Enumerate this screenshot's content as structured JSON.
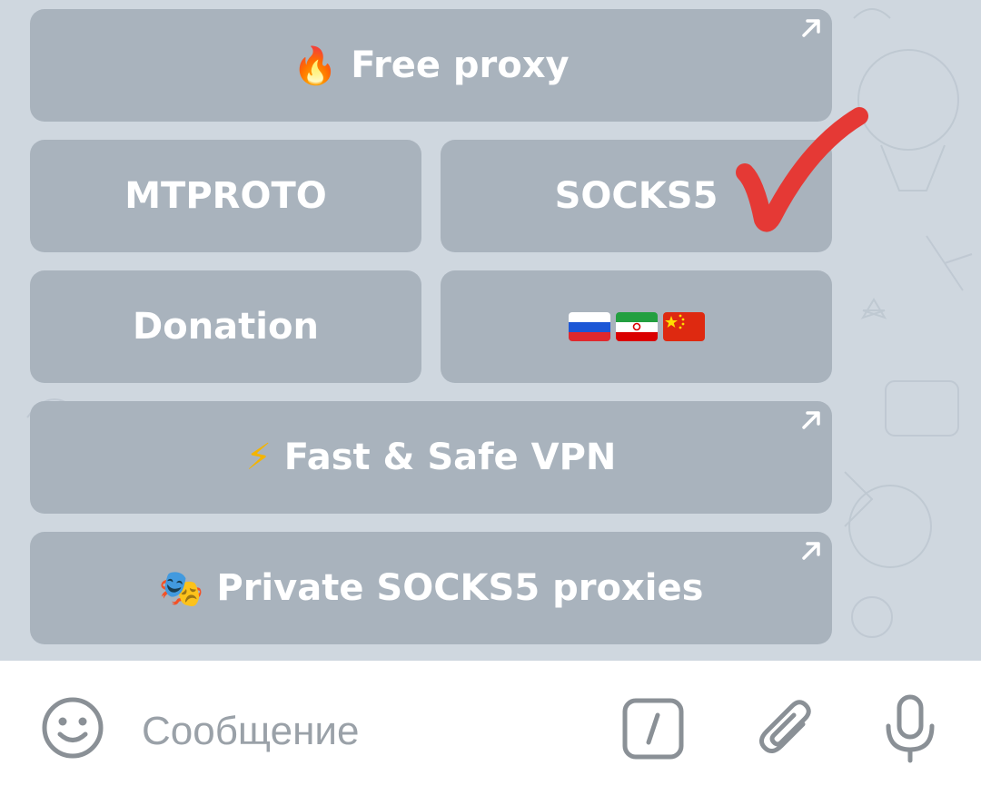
{
  "keyboard": {
    "free_proxy": {
      "emoji": "🔥",
      "label": "Free proxy",
      "has_link_arrow": true
    },
    "mtproto": {
      "label": "MTPROTO"
    },
    "socks5": {
      "label": "SOCKS5"
    },
    "donation": {
      "label": "Donation"
    },
    "flags": {
      "flags": [
        "russia-flag",
        "iran-flag",
        "china-flag"
      ]
    },
    "vpn": {
      "emoji": "⚡",
      "label": "Fast & Safe VPN",
      "has_link_arrow": true
    },
    "private_socks": {
      "emoji": "🎭",
      "label": "Private SOCKS5 proxies",
      "has_link_arrow": true
    }
  },
  "annotation": {
    "mark": "red-checkmark",
    "color": "#e53935"
  },
  "composer": {
    "placeholder": "Сообщение",
    "icons": [
      "emoji-icon",
      "bot-commands-icon",
      "attach-icon",
      "microphone-icon"
    ]
  },
  "colors": {
    "button_bg": "#a9b3bd",
    "chat_bg": "#cfd7df",
    "text_white": "#ffffff",
    "icon_gray": "#8a9096"
  }
}
